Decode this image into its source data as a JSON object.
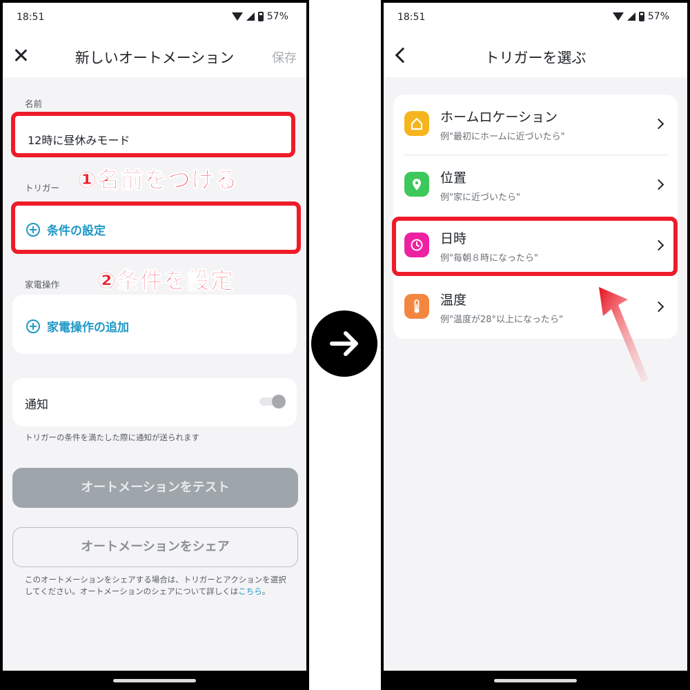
{
  "status": {
    "time": "18:51",
    "battery": "57%"
  },
  "left_screen": {
    "title": "新しいオートメーション",
    "save_label": "保存",
    "name_label": "名前",
    "name_value": "12時に昼休みモード",
    "trigger_label": "トリガー",
    "trigger_add": "条件の設定",
    "appliance_label": "家電操作",
    "appliance_add": "家電操作の追加",
    "notify_label": "通知",
    "notify_on": false,
    "notify_hint": "トリガーの条件を満たした際に通知が送られます",
    "test_button": "オートメーションをテスト",
    "share_button": "オートメーションをシェア",
    "share_note": "このオートメーションをシェアする場合は、トリガーとアクションを選択してください。オートメーションのシェアについて詳しくは",
    "share_link": "こちら",
    "share_note_end": "。"
  },
  "annotations": {
    "step1": "①名前をつける",
    "step2": "②条件を設定",
    "accent": "#ee1b2a"
  },
  "right_screen": {
    "title": "トリガーを選ぶ",
    "triggers": [
      {
        "title": "ホームロケーション",
        "example": "例\"最初にホームに近づいたら\"",
        "icon": "home-icon",
        "color": "#f6b51e"
      },
      {
        "title": "位置",
        "example": "例\"家に近づいたら\"",
        "icon": "location-pin-icon",
        "color": "#3cc85a"
      },
      {
        "title": "日時",
        "example": "例\"毎朝８時になったら\"",
        "icon": "clock-icon",
        "color": "#ee21a1"
      },
      {
        "title": "温度",
        "example": "例\"温度が28°以上になったら\"",
        "icon": "thermometer-icon",
        "color": "#f4873f"
      }
    ]
  },
  "colors": {
    "link": "#1e98c6",
    "disabled_button": "#9ea5ab",
    "background": "#f4f4f6"
  }
}
